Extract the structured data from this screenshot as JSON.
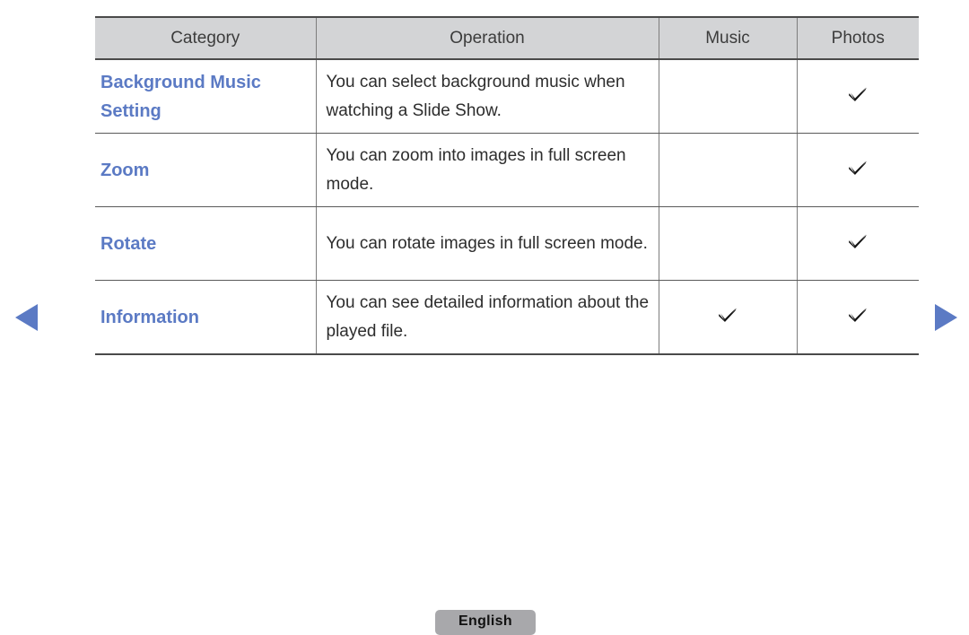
{
  "table": {
    "columns": [
      "Category",
      "Operation",
      "Music",
      "Photos"
    ],
    "rows": [
      {
        "category": "Background Music Setting",
        "operation": "You can select background music when watching a Slide Show.",
        "music": "",
        "photos": "check"
      },
      {
        "category": "Zoom",
        "operation": "You can zoom into images in full screen mode.",
        "music": "",
        "photos": "check"
      },
      {
        "category": "Rotate",
        "operation": "You can rotate images in full screen mode.",
        "music": "",
        "photos": "check"
      },
      {
        "category": "Information",
        "operation": "You can see detailed information about the played file.",
        "music": "check",
        "photos": "check"
      }
    ]
  },
  "nav": {
    "previous_icon": "triangle-left-icon",
    "next_icon": "triangle-right-icon"
  },
  "footer": {
    "language_label": "English"
  },
  "colors": {
    "category_text": "#5b7ac4",
    "header_background": "#d3d4d6",
    "arrow": "#5b7ac4",
    "language_button_background": "#a8a8ab"
  }
}
